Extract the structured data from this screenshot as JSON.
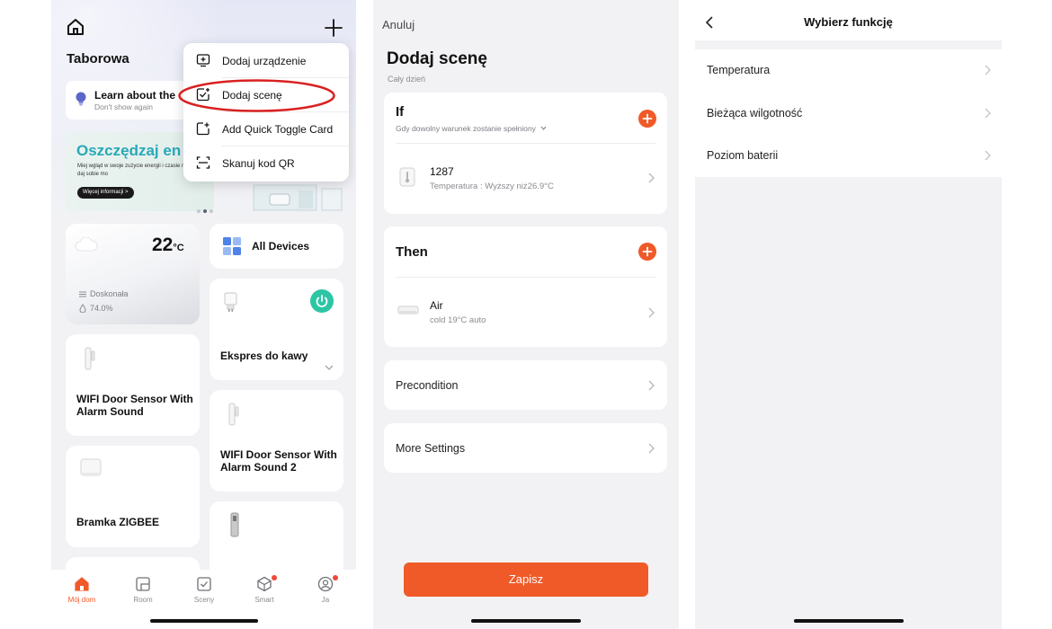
{
  "colors": {
    "accent": "#f05a28",
    "power_teal": "#2cc6a5",
    "highlight_red": "#d92020",
    "banner_title": "#28a9b8"
  },
  "screen1": {
    "home_name": "Taborowa",
    "learn_card": {
      "title": "Learn about the",
      "subtitle": "Don't show again"
    },
    "banner": {
      "title": "Oszczędzaj en",
      "text": "Miej wgląd w swoje zużycie energii i czasie rzeczywistym i daj sobie mo",
      "button": "Więcej informacji >",
      "page_count": 3,
      "active_page": 1
    },
    "weather": {
      "temp": "22",
      "unit": "°C",
      "condition": "Doskonała",
      "humidity": "74.0%"
    },
    "all_devices_label": "All Devices",
    "devices": [
      {
        "name": "Ekspres do kawy",
        "icon": "smart-plug-icon",
        "power_on": true
      },
      {
        "name": "WIFI Door Sensor With Alarm Sound",
        "icon": "door-sensor-icon"
      },
      {
        "name": "WIFI Door Sensor With Alarm Sound 2",
        "icon": "door-sensor-icon"
      },
      {
        "name": "Bramka ZIGBEE",
        "icon": "gateway-icon"
      }
    ],
    "menu": [
      {
        "label": "Dodaj urządzenie",
        "icon": "add-device-icon"
      },
      {
        "label": "Dodaj scenę",
        "icon": "add-scene-icon",
        "highlighted": true
      },
      {
        "label": "Add Quick Toggle Card",
        "icon": "add-card-icon"
      },
      {
        "label": "Skanuj kod QR",
        "icon": "scan-icon"
      }
    ],
    "tabs": [
      {
        "label": "Mój dom",
        "icon": "home-tab-icon",
        "active": true
      },
      {
        "label": "Room",
        "icon": "room-tab-icon"
      },
      {
        "label": "Sceny",
        "icon": "scenes-tab-icon"
      },
      {
        "label": "Smart",
        "icon": "smart-tab-icon",
        "badge": true
      },
      {
        "label": "Ja",
        "icon": "profile-tab-icon",
        "badge": true
      }
    ]
  },
  "screen2": {
    "cancel": "Anuluj",
    "title": "Dodaj scenę",
    "subtitle": "Cały dzień",
    "if_section": {
      "title": "If",
      "subtitle": "Gdy dowolny warunek zostanie spełniony",
      "condition": {
        "name": "1287",
        "detail": "Temperatura : Wyższy niż26.9°C"
      }
    },
    "then_section": {
      "title": "Then",
      "action": {
        "name": "Air",
        "detail": "cold 19°C auto"
      }
    },
    "precondition": "Precondition",
    "more_settings": "More Settings",
    "save": "Zapisz"
  },
  "screen3": {
    "title": "Wybierz funkcję",
    "functions": [
      "Temperatura",
      "Bieżąca wilgotność",
      "Poziom baterii"
    ]
  }
}
